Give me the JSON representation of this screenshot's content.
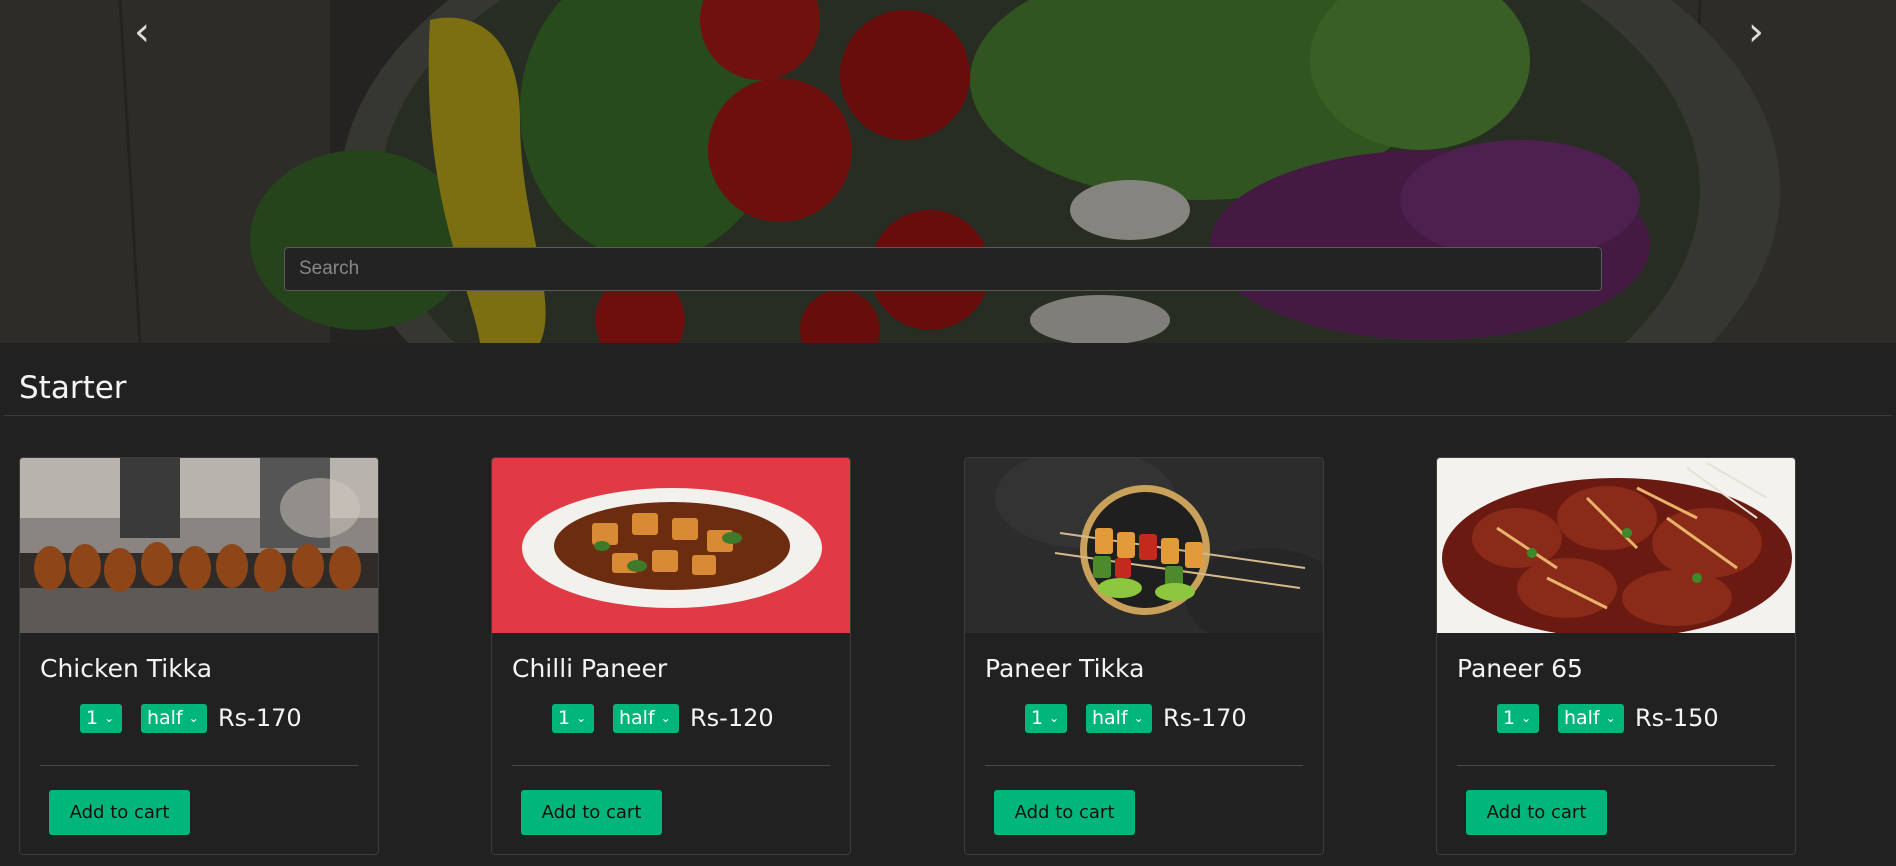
{
  "carousel": {
    "prev_icon": "chevron-left-icon",
    "next_icon": "chevron-right-icon",
    "prev_glyph": "‹",
    "next_glyph": "›"
  },
  "search": {
    "placeholder": "Search",
    "value": ""
  },
  "section": {
    "title": "Starter"
  },
  "colors": {
    "accent": "#00b67a",
    "background": "#212121"
  },
  "items": [
    {
      "name": "Chicken Tikka",
      "qty": "1",
      "size": "half",
      "price": "Rs-170",
      "cta": "Add to cart"
    },
    {
      "name": "Chilli Paneer",
      "qty": "1",
      "size": "half",
      "price": "Rs-120",
      "cta": "Add to cart"
    },
    {
      "name": "Paneer Tikka",
      "qty": "1",
      "size": "half",
      "price": "Rs-170",
      "cta": "Add to cart"
    },
    {
      "name": "Paneer 65",
      "qty": "1",
      "size": "half",
      "price": "Rs-150",
      "cta": "Add to cart"
    }
  ]
}
